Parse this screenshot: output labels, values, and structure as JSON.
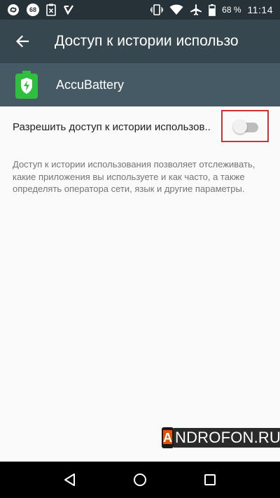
{
  "status_bar": {
    "badge_count": "68",
    "battery_percent": "68 %",
    "time": "11:14",
    "icons": [
      "shazam-icon",
      "notification-count-icon",
      "clipboard-x-icon",
      "app-check-icon",
      "vibrate-icon",
      "wifi-icon",
      "airplane-icon",
      "battery-icon"
    ]
  },
  "toolbar": {
    "title": "Доступ к истории использо"
  },
  "app": {
    "name": "AccuBattery",
    "icon_color": "#2fbf3f"
  },
  "permission": {
    "label": "Разрешить доступ к истории использов..",
    "enabled": false
  },
  "description": "Доступ к истории использования позволяет отслеживать, какие приложения вы используете и как часто, а также определять оператора сети, язык и другие параметры.",
  "watermark": {
    "letter": "A",
    "text": "NDROFON.RU"
  },
  "colors": {
    "status_bar": "#263238",
    "toolbar": "#37474f",
    "app_header": "#455a64",
    "highlight": "#d32f2f"
  }
}
